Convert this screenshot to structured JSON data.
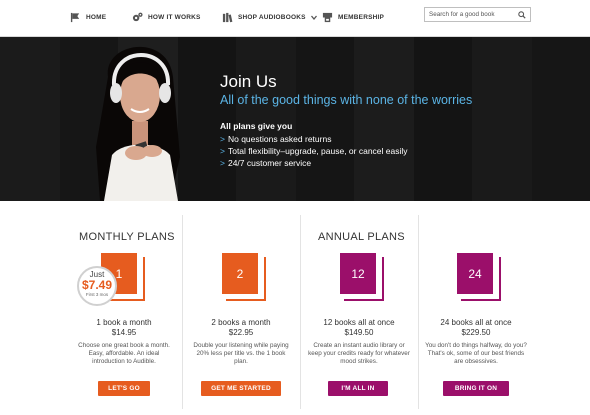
{
  "nav": {
    "items": [
      {
        "label": "HOME",
        "icon": "home-flag-icon"
      },
      {
        "label": "HOW IT WORKS",
        "icon": "gears-icon"
      },
      {
        "label": "SHOP AUDIOBOOKS",
        "icon": "books-icon"
      },
      {
        "label": "MEMBERSHIP",
        "icon": "membership-icon"
      }
    ],
    "search_placeholder": "Search for a good book"
  },
  "hero": {
    "title": "Join Us",
    "subtitle": "All of the good things with none of the worries",
    "list_heading": "All plans give you",
    "bullets": [
      "No questions asked returns",
      "Total flexibility–upgrade, pause, or cancel easily",
      "24/7 customer service"
    ],
    "chevron": ">"
  },
  "monthly": {
    "heading": "MONTHLY PLANS",
    "badge": {
      "line1": "Just",
      "price": "$7.49",
      "line3": "First 3 mos"
    },
    "plans": [
      {
        "count": "1",
        "name": "1 book a month",
        "price": "$14.95",
        "desc": "Choose one great book a month. Easy, affordable. An ideal introduction to Audible.",
        "button": "LET'S GO"
      },
      {
        "count": "2",
        "name": "2 books a month",
        "price": "$22.95",
        "desc": "Double your listening while paying 20% less per title vs. the 1 book plan.",
        "button": "GET ME STARTED"
      }
    ]
  },
  "annual": {
    "heading": "ANNUAL PLANS",
    "plans": [
      {
        "count": "12",
        "name": "12 books all at once",
        "price": "$149.50",
        "desc": "Create an instant audio library or keep your credits ready for whatever mood strikes.",
        "button": "I'M ALL IN"
      },
      {
        "count": "24",
        "name": "24 books all at once",
        "price": "$229.50",
        "desc": "You don't do things halfway, do you? That's ok, some of our best friends are obsessives.",
        "button": "BRING IT ON"
      }
    ]
  },
  "colors": {
    "orange": "#e65c1f",
    "purple": "#9b0f6a",
    "accent_blue": "#5bb4e5"
  }
}
